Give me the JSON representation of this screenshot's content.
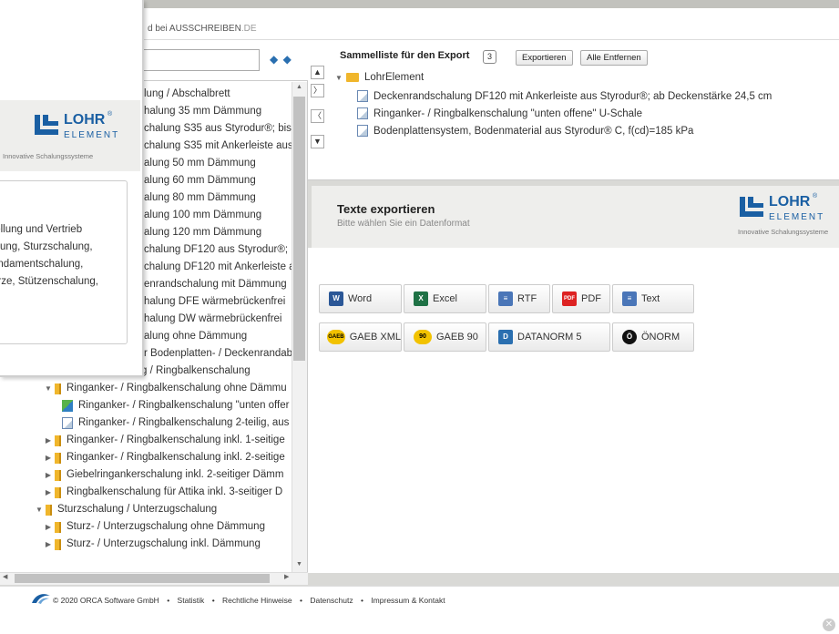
{
  "subbar": {
    "text": "d bei AUSSCHREIBEN",
    "suffix": ".DE"
  },
  "search": {
    "placeholder": "",
    "prev_icon": "arrow-left-icon",
    "next_icon": "arrow-right-icon",
    "arrows": "◆ ◆"
  },
  "tree": {
    "items": [
      {
        "label": "lung / Abschalbrett",
        "kind": "none",
        "level": 0,
        "tw": ""
      },
      {
        "label": "halung 35 mm Dämmung",
        "kind": "none",
        "level": 0,
        "tw": ""
      },
      {
        "label": "chalung S35 aus Styrodur®; bis",
        "kind": "none",
        "level": 0,
        "tw": ""
      },
      {
        "label": "chalung S35 mit Ankerleiste aus",
        "kind": "none",
        "level": 0,
        "tw": ""
      },
      {
        "label": "alung 50 mm Dämmung",
        "kind": "none",
        "level": 0,
        "tw": ""
      },
      {
        "label": "alung 60 mm Dämmung",
        "kind": "none",
        "level": 0,
        "tw": ""
      },
      {
        "label": "alung 80 mm Dämmung",
        "kind": "none",
        "level": 0,
        "tw": ""
      },
      {
        "label": "alung 100 mm Dämmung",
        "kind": "none",
        "level": 0,
        "tw": ""
      },
      {
        "label": "alung 120 mm Dämmung",
        "kind": "none",
        "level": 0,
        "tw": ""
      },
      {
        "label": "chalung DF120 aus Styrodur®;",
        "kind": "none",
        "level": 0,
        "tw": ""
      },
      {
        "label": "chalung DF120 mit Ankerleiste a",
        "kind": "none",
        "level": 0,
        "tw": ""
      },
      {
        "label": "enrandschalung mit Dämmung",
        "kind": "none",
        "level": 0,
        "tw": ""
      },
      {
        "label": "halung DFE wärmebrückenfrei",
        "kind": "none",
        "level": 0,
        "tw": ""
      },
      {
        "label": "halung DW wärmebrückenfrei",
        "kind": "none",
        "level": 0,
        "tw": ""
      },
      {
        "label": "alung ohne Dämmung",
        "kind": "none",
        "level": 0,
        "tw": ""
      },
      {
        "label": "r Bodenplatten- / Deckenrandab",
        "kind": "none",
        "level": 0,
        "tw": ""
      },
      {
        "label": "Ringankerschalung / Ringbalkenschalung",
        "kind": "folder",
        "level": 1,
        "tw": "▼"
      },
      {
        "label": "Ringanker- / Ringbalkenschalung ohne Dämmu",
        "kind": "folder",
        "level": 2,
        "tw": "▼"
      },
      {
        "label": "Ringanker- / Ringbalkenschalung \"unten offer",
        "kind": "doc-color",
        "level": 3,
        "tw": ""
      },
      {
        "label": "Ringanker- / Ringbalkenschalung 2-teilig, aus",
        "kind": "doc",
        "level": 3,
        "tw": ""
      },
      {
        "label": "Ringanker- / Ringbalkenschalung inkl. 1-seitige",
        "kind": "folder",
        "level": 2,
        "tw": "▶"
      },
      {
        "label": "Ringanker- / Ringbalkenschalung inkl. 2-seitige",
        "kind": "folder",
        "level": 2,
        "tw": "▶"
      },
      {
        "label": "Giebelringankerschalung inkl. 2-seitiger Dämm",
        "kind": "folder",
        "level": 2,
        "tw": "▶"
      },
      {
        "label": "Ringbalkenschalung für Attika inkl. 3-seitiger D",
        "kind": "folder",
        "level": 2,
        "tw": "▶"
      },
      {
        "label": "Sturzschalung / Unterzugschalung",
        "kind": "folder",
        "level": 1,
        "tw": "▼"
      },
      {
        "label": "Sturz- / Unterzugschalung ohne Dämmung",
        "kind": "folder",
        "level": 2,
        "tw": "▶"
      },
      {
        "label": "Sturz- / Unterzugschalung inkl. Dämmung",
        "kind": "folder",
        "level": 2,
        "tw": "▶"
      }
    ]
  },
  "popup": {
    "logo": {
      "word": "LOHR",
      "reg": "®",
      "sub": "ELEMENT",
      "tagline": "Innovative Schalungssysteme"
    },
    "desc_lines": [
      "tellung und Vertrieb",
      "alung, Sturzschalung,",
      "undamentschalung,",
      "ürze, Stützenschalung,"
    ]
  },
  "sammelliste": {
    "title": "Sammelliste für den Export",
    "count": "3",
    "export_label": "Exportieren",
    "remove_all_label": "Alle Entfernen",
    "root_label": "LohrElement",
    "items": [
      "Deckenrandschalung DF120 mit Ankerleiste aus Styrodur®; ab Deckenstärke 24,5 cm",
      "Ringanker- / Ringbalkenschalung \"unten offene\" U-Schale",
      "Bodenplattensystem, Bodenmaterial aus Styrodur® C, f(cd)=185 kPa"
    ],
    "move_buttons": [
      "▲",
      "〉",
      "〈",
      "▼"
    ]
  },
  "texte": {
    "title": "Texte exportieren",
    "subtitle": "Bitte wählen Sie ein Datenformat",
    "logo": {
      "word": "LOHR",
      "reg": "®",
      "sub": "ELEMENT",
      "tagline": "Innovative Schalungssysteme"
    }
  },
  "formats": {
    "row1": [
      {
        "label": "Word",
        "icon": "word-icon",
        "abbr": "W",
        "color": "#2b5797"
      },
      {
        "label": "Excel",
        "icon": "excel-icon",
        "abbr": "X",
        "color": "#1e7145"
      },
      {
        "label": "RTF",
        "icon": "rtf-icon",
        "abbr": "≡",
        "color": "#4a76b8"
      },
      {
        "label": "PDF",
        "icon": "pdf-icon",
        "abbr": "PDF",
        "color": "#d22"
      },
      {
        "label": "Text",
        "icon": "text-icon",
        "abbr": "≡",
        "color": "#4a76b8"
      }
    ],
    "row2": [
      {
        "label": "GAEB XML",
        "icon": "gaeb-xml-icon",
        "abbr": "GAEB",
        "color": "#f2c200"
      },
      {
        "label": "GAEB 90",
        "icon": "gaeb-90-icon",
        "abbr": "90",
        "color": "#f2c200"
      },
      {
        "label": "DATANORM 5",
        "icon": "datanorm-icon",
        "abbr": "D",
        "color": "#2a6fb0"
      },
      {
        "label": "ÖNORM",
        "icon": "onorm-icon",
        "abbr": "Ö",
        "color": "#111"
      }
    ]
  },
  "footer": {
    "copyright": "© 2020 ORCA Software GmbH",
    "links": [
      "Statistik",
      "Rechtliche Hinweise",
      "Datenschutz",
      "Impressum & Kontakt"
    ],
    "separator": "•"
  }
}
